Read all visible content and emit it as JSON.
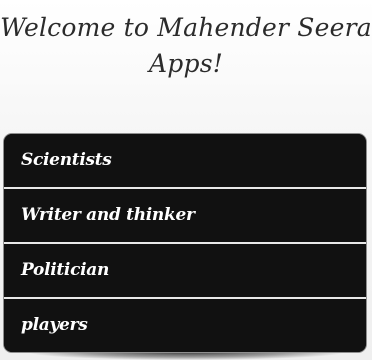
{
  "header": {
    "title_line1": "Welcome to Mahender Seera",
    "title_line2": "Apps!"
  },
  "menu": {
    "items": [
      {
        "label": "Scientists"
      },
      {
        "label": "Writer and thinker"
      },
      {
        "label": "Politician"
      },
      {
        "label": "players"
      }
    ]
  },
  "colors": {
    "menu_background": "#111111",
    "menu_text": "#ffffff",
    "divider": "#e8e8e8",
    "title_text": "#2b2b2b"
  }
}
